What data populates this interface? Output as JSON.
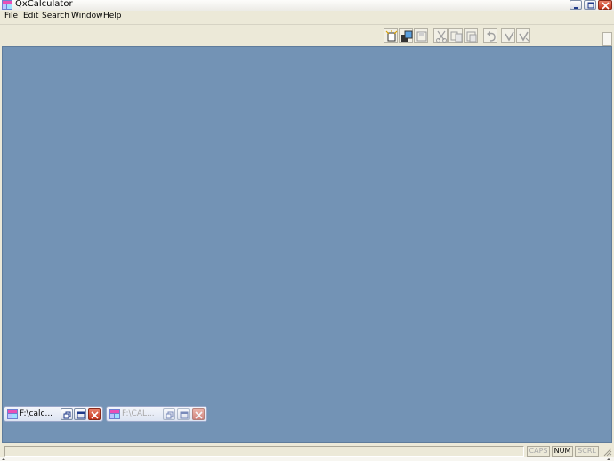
{
  "window": {
    "title": "QxCalculator",
    "controls": [
      "minimize",
      "maximize",
      "close"
    ]
  },
  "menu": {
    "items": [
      {
        "label": "File",
        "name": "menu-file"
      },
      {
        "label": "Edit",
        "name": "menu-edit"
      },
      {
        "label": "Search",
        "name": "menu-search"
      },
      {
        "label": "Window",
        "name": "menu-window"
      },
      {
        "label": "Help",
        "name": "menu-help"
      }
    ]
  },
  "toolbar": {
    "buttons": [
      {
        "icon": "new-icon",
        "enabled": true
      },
      {
        "icon": "open-icon",
        "enabled": true
      },
      {
        "icon": "save-icon",
        "enabled": false
      },
      {
        "icon": "cut-icon",
        "enabled": false
      },
      {
        "icon": "copy-icon",
        "enabled": false
      },
      {
        "icon": "paste-icon",
        "enabled": false
      },
      {
        "icon": "undo-icon",
        "enabled": false
      },
      {
        "icon": "run-icon",
        "enabled": false
      },
      {
        "icon": "run-all-icon",
        "enabled": false
      }
    ]
  },
  "mdi": {
    "background": "#7393b5",
    "minimized_windows": [
      {
        "title": "F:\\calc...",
        "active": true
      },
      {
        "title": "F:\\CAL...",
        "active": false
      }
    ]
  },
  "statusbar": {
    "message": "",
    "caps": "CAPS",
    "num": "NUM",
    "scrl": "SCRL"
  }
}
